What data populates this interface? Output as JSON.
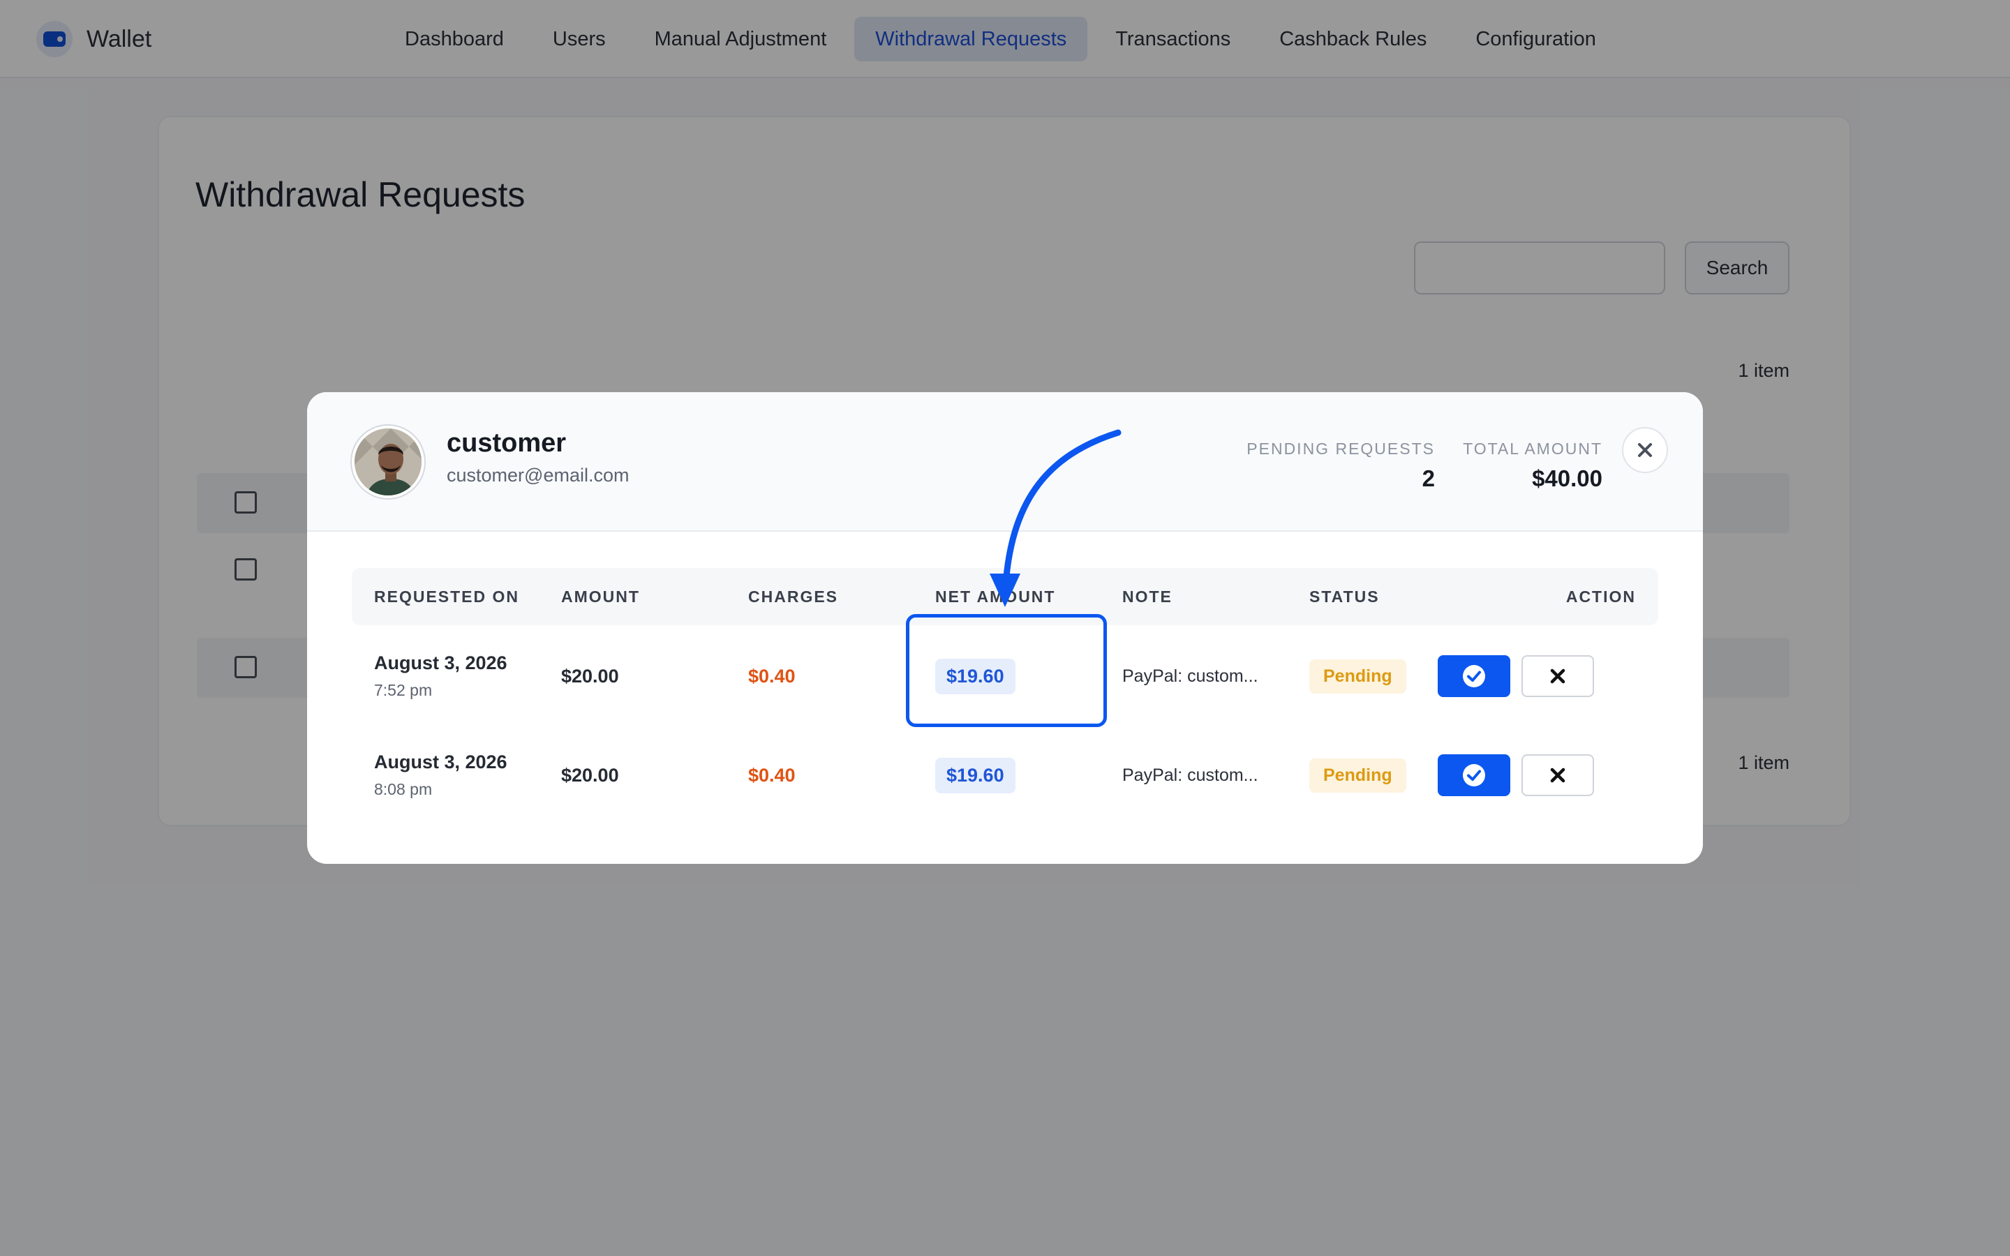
{
  "app": {
    "title": "Wallet"
  },
  "nav": {
    "items": [
      {
        "label": "Dashboard"
      },
      {
        "label": "Users"
      },
      {
        "label": "Manual Adjustment"
      },
      {
        "label": "Withdrawal Requests"
      },
      {
        "label": "Transactions"
      },
      {
        "label": "Cashback Rules"
      },
      {
        "label": "Configuration"
      }
    ],
    "active": "Withdrawal Requests"
  },
  "page": {
    "title": "Withdrawal Requests",
    "search": {
      "value": "",
      "button_label": "Search"
    },
    "count_top": "1 item",
    "count_bottom": "1 item"
  },
  "modal": {
    "user": {
      "name": "customer",
      "email": "customer@email.com"
    },
    "stats": {
      "pending_label": "PENDING REQUESTS",
      "pending_value": "2",
      "total_label": "TOTAL AMOUNT",
      "total_value": "$40.00"
    },
    "columns": [
      "REQUESTED ON",
      "AMOUNT",
      "CHARGES",
      "NET AMOUNT",
      "NOTE",
      "STATUS",
      "ACTION"
    ],
    "rows": [
      {
        "date": "August 3, 2026",
        "time": "7:52 pm",
        "amount": "$20.00",
        "charges": "$0.40",
        "net": "$19.60",
        "note": "PayPal: custom...",
        "status": "Pending"
      },
      {
        "date": "August 3, 2026",
        "time": "8:08 pm",
        "amount": "$20.00",
        "charges": "$0.40",
        "net": "$19.60",
        "note": "PayPal: custom...",
        "status": "Pending"
      }
    ]
  },
  "icons": {
    "close": "close-icon",
    "approve": "check-circle-icon",
    "reject": "x-icon"
  },
  "colors": {
    "accent": "#0b57f0",
    "charges": "#e05313",
    "pending": "#dd9a12"
  }
}
